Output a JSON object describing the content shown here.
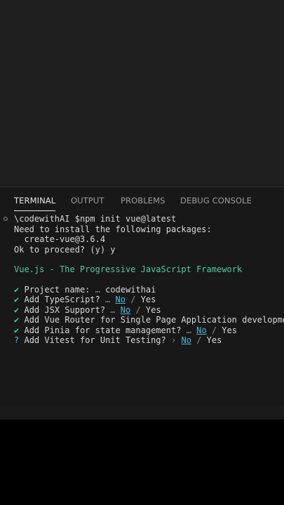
{
  "tabs": [
    {
      "label": "TERMINAL",
      "active": true
    },
    {
      "label": "OUTPUT",
      "active": false
    },
    {
      "label": "PROBLEMS",
      "active": false
    },
    {
      "label": "DEBUG CONSOLE",
      "active": false
    }
  ],
  "terminal": {
    "prompt_path": "\\codewithAI",
    "prompt_command": "$npm init vue@latest",
    "install_msg": "Need to install the following packages:",
    "package": "  create-vue@3.6.4",
    "proceed": "Ok to proceed? (y) y",
    "banner": "Vue.js - The Progressive JavaScript Framework",
    "answers": [
      {
        "mark": "✔",
        "question": "Project name:",
        "sep": "…",
        "answer": "codewithai",
        "type": "text"
      },
      {
        "mark": "✔",
        "question": "Add TypeScript?",
        "sep": "…",
        "no": "No",
        "slash": "/",
        "yes": "Yes",
        "type": "choice"
      },
      {
        "mark": "✔",
        "question": "Add JSX Support?",
        "sep": "…",
        "no": "No",
        "slash": "/",
        "yes": "Yes",
        "type": "choice"
      },
      {
        "mark": "✔",
        "question": "Add Vue Router for Single Page Application development?",
        "type": "plain"
      },
      {
        "mark": "✔",
        "question": "Add Pinia for state management?",
        "sep": "…",
        "no": "No",
        "slash": "/",
        "yes": "Yes",
        "type": "choice"
      },
      {
        "mark": "?",
        "question": "Add Vitest for Unit Testing?",
        "sep": "›",
        "no": "No",
        "slash": "/",
        "yes": "Yes",
        "type": "choice"
      }
    ]
  },
  "colors": {
    "panel_bg": "#181818",
    "editor_bg": "#1e1e1e",
    "accent_green": "#4ec9a0",
    "accent_cyan": "#4fb8d8"
  }
}
